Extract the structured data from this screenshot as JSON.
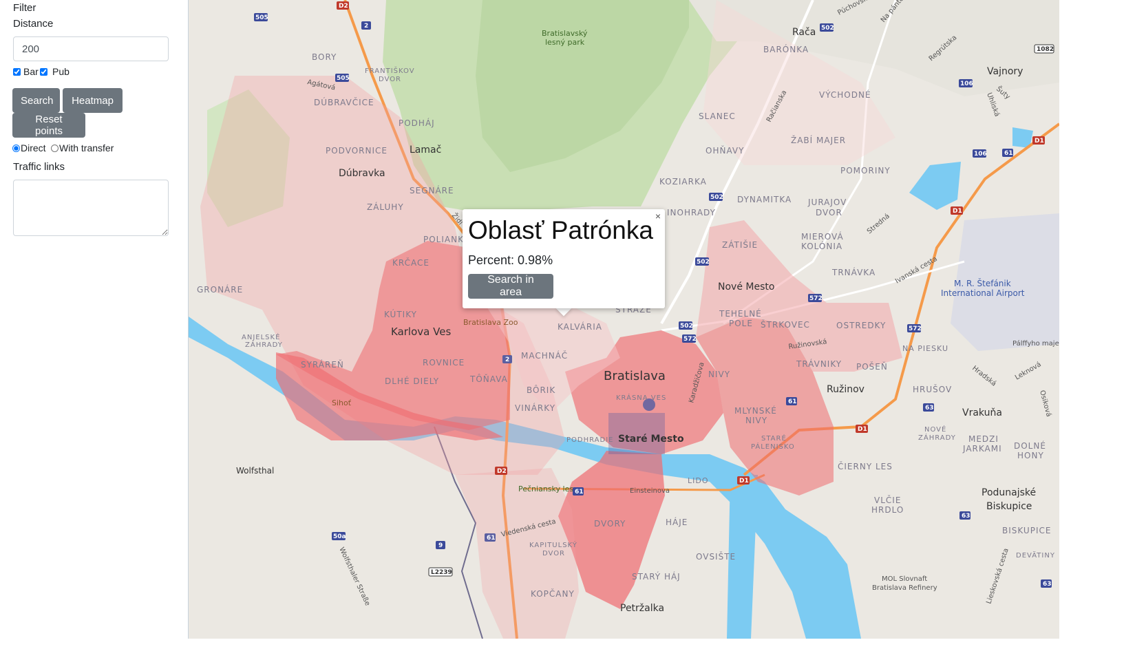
{
  "sidebar": {
    "filter_label": "Filter",
    "distance_label": "Distance",
    "distance_value": "200",
    "checkbox_bar": "Bar",
    "checkbox_pub": "Pub",
    "search_button": "Search",
    "heatmap_button": "Heatmap",
    "reset_button": "Reset points",
    "radio_direct": "Direct",
    "radio_transfer": "With transfer",
    "traffic_label": "Traffic links",
    "traffic_value": ""
  },
  "map": {
    "labels": {
      "bratislava": "Bratislava",
      "stare_mesto": "Staré Mesto",
      "nove_mesto": "Nové Mesto",
      "karlova_ves": "Karlova Ves",
      "dubravka": "Dúbravka",
      "lamac": "Lamač",
      "raca": "Rača",
      "vajnory": "Vajnory",
      "ruzinov": "Ružinov",
      "vrakuna": "Vrakuňa",
      "petrzalka": "Petržalka",
      "podunajske": "Podunajské",
      "biskupice": "Biskupice",
      "wolfsthal": "Wolfsthal",
      "airport1": "M. R. Štefánik",
      "airport2": "International Airport",
      "lesny_park1": "Bratislavský",
      "lesny_park2": "lesný park",
      "zoo": "Bratislava Zoo",
      "sihot": "Sihoť",
      "pecniansky": "Pečniansky les",
      "refinery1": "MOL Slovnaft",
      "refinery2": "Bratislava Refinery",
      "bory": "BORY",
      "frantiskov1": "FRANTIŠKOV",
      "frantiskov2": "DVOR",
      "dubravcice": "DÚBRAVČICE",
      "podhaj": "PODHÁJ",
      "podvornice": "PODVORNICE",
      "segnare": "SEGNÁRE",
      "zaluhy": "ZÁLUHY",
      "polianky": "POLIANK",
      "krcace": "KRČACE",
      "gronare": "GRONÁRE",
      "kutiky": "KÚTIKY",
      "anjelske1": "ANJELSKÉ",
      "anjelske2": "ZÁHRADY",
      "syraren": "SYRÁREŇ",
      "rovnice": "ROVNICE",
      "dlhe_diely": "DLHÉ DIELY",
      "tonava": "TÔŇAVA",
      "kalvaria": "KALVÁRIA",
      "machnac": "MACHNÁČ",
      "borik": "BÔRIK",
      "vinarky": "VINÁRKY",
      "podhradie": "PODHRADIE",
      "krasna_ves": "KRÁSNA VES",
      "straze": "STRÁŽE",
      "baronka": "BARÓNKA",
      "vychodne": "VÝCHODNÉ",
      "slanec": "SLANEC",
      "ohnavy": "OHŇAVY",
      "zabi_majer": "ŽABÍ MAJER",
      "koziarka": "KOZIARKA",
      "pomoriny": "POMORINY",
      "dynamitka": "DYNAMITKA",
      "jurajov1": "JURAJOV",
      "jurajov2": "DVOR",
      "vinohrady": "INOHRADY",
      "zatisie": "ZÁTIŠIE",
      "mierova1": "MIEROVÁ",
      "mierova2": "KOLÓNIA",
      "trnavka": "TRNÁVKA",
      "tehelne1": "TEHELNÉ",
      "tehelne2": "POLE",
      "strkovec": "ŠTRKOVEC",
      "ostredky": "OSTREDKY",
      "travniky": "TRÁVNIKY",
      "posen": "POŠEŇ",
      "na_piesku": "NA PIESKU",
      "nivy": "NIVY",
      "mlynske1": "MLYNSKÉ",
      "mlynske2": "NIVY",
      "stare_palenisko1": "STARÉ",
      "stare_palenisko2": "PÁLENISKO",
      "hruskov": "HRUŠOV",
      "nove_zahrady1": "NOVÉ",
      "nove_zahrady2": "ZÁHRADY",
      "medzi_jarkami1": "MEDZI",
      "medzi_jarkami2": "JARKAMI",
      "dolne_hony1": "DOLNÉ",
      "dolne_hony2": "HONY",
      "cierny_les": "ČIERNY LES",
      "vlcie_hrdlo1": "VLČIE",
      "vlcie_hrdlo2": "HRDLO",
      "biskupice2": "BISKUPICE",
      "devatiny": "DEVÄTINY",
      "lido": "LIDO",
      "einsteinova": "Einsteinova",
      "dvory": "DVORY",
      "haje": "HÁJE",
      "ovsiste": "OVSIŠTE",
      "stary_haj": "STARÝ HÁJ",
      "kapitulsky1": "KAPITULSKÝ",
      "kapitulsky2": "DVOR",
      "kopcany": "KOPČANY",
      "viedenska": "Viedenská cesta",
      "wolfsthaler": "Wolfsthaler Straße",
      "palffyho": "Pálffyho majer",
      "agatova": "Agátová",
      "racianska": "Račianska",
      "ivanska": "Ivanská cesta",
      "karadzicova": "Karadžičova",
      "ruzinovska": "Ružinovská",
      "puchovska": "Púchovská",
      "regrutska": "Regrútska",
      "uhliska": "Uhliská",
      "suty": "Šuty",
      "hradska": "Hradská",
      "leknova": "Leknová",
      "osikova": "Osiková",
      "lieskovska": "Lieskovská cesta",
      "stredna": "Stredná",
      "na_pantoch": "Na pántoch",
      "zidlicka": "Židl"
    },
    "shields": {
      "d2a": "D2",
      "d2b": "D2",
      "r2": "2",
      "r2b": "2",
      "r505a": "505",
      "r505b": "505",
      "r502a": "502",
      "r502b": "502",
      "r502c": "502",
      "r572a": "572",
      "r572b": "572",
      "r572c": "572",
      "r106a": "106",
      "r106b": "106",
      "r61a": "61",
      "r61b": "61",
      "r61c": "61",
      "r61d": "61",
      "r63a": "63",
      "r63b": "63",
      "r63c": "63",
      "d1a": "D1",
      "d1b": "D1",
      "d1c": "D1",
      "d1d": "D1",
      "r1082": "1082",
      "r9": "9",
      "r50a": "50a",
      "l2239": "L2239"
    }
  },
  "popup": {
    "title": "Oblasť Patrónka",
    "percent_text": "Percent: 0.98%",
    "button_label": "Search in area",
    "close_label": "×"
  }
}
